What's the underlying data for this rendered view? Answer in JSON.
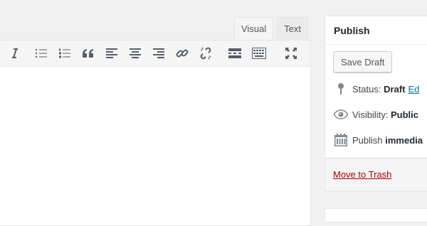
{
  "editor": {
    "tabs": {
      "visual": "Visual",
      "text": "Text"
    },
    "toolbar_icons": [
      "italic-icon",
      "bulleted-list-icon",
      "numbered-list-icon",
      "blockquote-icon",
      "align-left-icon",
      "align-center-icon",
      "align-right-icon",
      "insert-link-icon",
      "remove-link-icon",
      "read-more-icon",
      "toolbar-toggle-icon",
      "fullscreen-icon"
    ]
  },
  "publish": {
    "title": "Publish",
    "save_draft_label": "Save Draft",
    "status_label": "Status:",
    "status_value": "Draft",
    "status_edit": "Ed",
    "visibility_label": "Visibility:",
    "visibility_value": "Public",
    "publish_label": "Publish",
    "publish_value": "immedia",
    "trash_label": "Move to Trash",
    "icons": {
      "status": "pin-icon",
      "visibility": "eye-icon",
      "schedule": "calendar-icon"
    }
  },
  "colors": {
    "link": "#0073aa",
    "trash": "#a00",
    "background": "#f1f1f1",
    "icon": "#555d66"
  }
}
